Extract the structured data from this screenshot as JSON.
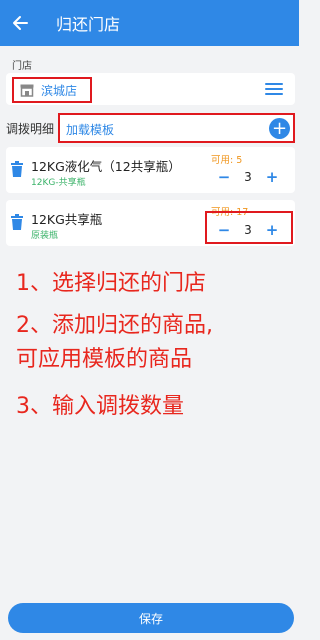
{
  "header": {
    "title": "归还门店"
  },
  "store": {
    "label": "门店",
    "name": "滨城店"
  },
  "transfer": {
    "label": "调拨明细",
    "template_link": "加载模板"
  },
  "items": [
    {
      "name": "12KG液化气（12共享瓶）",
      "sub": "12KG-共享瓶",
      "available": "可用: 5",
      "quantity": "3"
    },
    {
      "name": "12KG共享瓶",
      "sub": "原装瓶",
      "available": "可用: 17",
      "quantity": "3"
    }
  ],
  "instructions": {
    "line1": "1、选择归还的门店",
    "line2": "2、添加归还的商品,",
    "line3": "可应用模板的商品",
    "line4": "3、输入调拨数量"
  },
  "footer": {
    "save_label": "保存"
  },
  "colors": {
    "primary": "#2f88e6",
    "annotation": "#e0191e",
    "green": "#3cb36a",
    "orange": "#f0961e"
  },
  "icons": [
    "back-arrow-icon",
    "store-icon",
    "menu-icon",
    "add-icon",
    "trash-icon",
    "minus-icon",
    "plus-icon"
  ]
}
